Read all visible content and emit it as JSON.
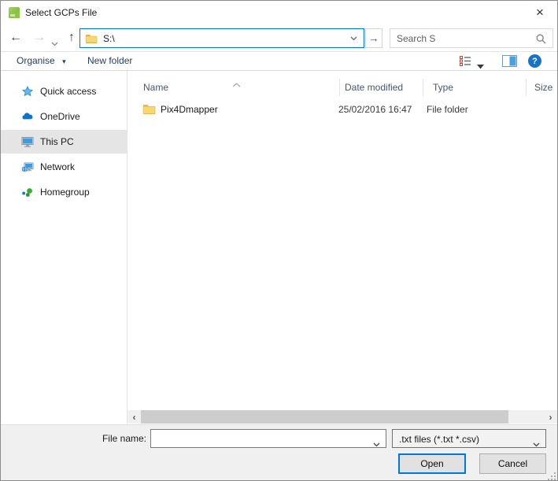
{
  "window": {
    "title": "Select GCPs File",
    "close_glyph": "×"
  },
  "nav": {
    "back_glyph": "←",
    "forward_glyph": "→",
    "up_glyph": "↑",
    "go_glyph": "→",
    "address_value": "S:\\",
    "search_placeholder": "Search S"
  },
  "toolbar": {
    "organise_label": "Organise",
    "organise_caret": "▾",
    "new_folder_label": "New folder",
    "help_glyph": "?"
  },
  "sidebar": {
    "items": [
      {
        "label": "Quick access"
      },
      {
        "label": "OneDrive"
      },
      {
        "label": "This PC",
        "selected": true
      },
      {
        "label": "Network"
      },
      {
        "label": "Homegroup"
      }
    ]
  },
  "list": {
    "columns": [
      "Name",
      "Date modified",
      "Type",
      "Size"
    ],
    "rows": [
      {
        "name": "Pix4Dmapper",
        "date_modified": "25/02/2016 16:47",
        "type": "File folder",
        "size": ""
      }
    ]
  },
  "scrollbar": {
    "left_glyph": "‹",
    "right_glyph": "›"
  },
  "footer": {
    "file_name_label": "File name:",
    "file_name_value": "",
    "file_type_value": ".txt files (*.txt *.csv)",
    "open_label": "Open",
    "cancel_label": "Cancel"
  },
  "colors": {
    "accent": "#0078d7",
    "selection_gray": "#e5e5e5",
    "folder_yellow": "#f7d774",
    "toolbar_link": "#1e3c5f",
    "header_text": "#47586e"
  }
}
